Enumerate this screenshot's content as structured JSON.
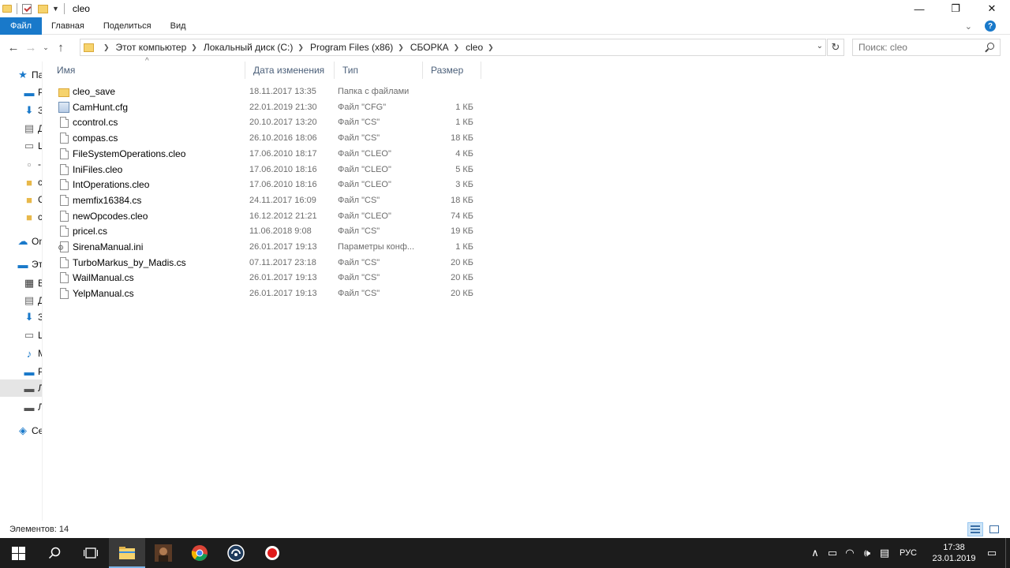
{
  "window": {
    "title": "cleo",
    "controls": [
      "minimize-icon",
      "restore-icon",
      "close-icon"
    ]
  },
  "ribbon": {
    "tabs": [
      "Файл",
      "Главная",
      "Поделиться",
      "Вид"
    ]
  },
  "address": {
    "crumbs": [
      "Этот компьютер",
      "Локальный диск (C:)",
      "Program Files (x86)",
      "СБОРКА",
      "cleo"
    ]
  },
  "search": {
    "placeholder": "Поиск: cleo"
  },
  "sidebar": {
    "items": [
      {
        "label": "Па",
        "icon": "star-icon",
        "color": "#1979ca"
      },
      {
        "label": "Р",
        "icon": "desktop-icon",
        "color": "#1979ca"
      },
      {
        "label": "З",
        "icon": "download-icon",
        "color": "#1979ca"
      },
      {
        "label": "Д",
        "icon": "document-icon",
        "color": "#666666"
      },
      {
        "label": "Ш",
        "icon": "window-icon",
        "color": "#666666"
      },
      {
        "label": "-",
        "icon": "file-icon",
        "color": "#888888"
      },
      {
        "label": "с",
        "icon": "folder-icon",
        "color": "#e8b84a"
      },
      {
        "label": "С",
        "icon": "folder-icon",
        "color": "#e8b84a"
      },
      {
        "label": "с",
        "icon": "folder-icon",
        "color": "#e8b84a"
      },
      {
        "label": "On",
        "icon": "cloud-icon",
        "color": "#1979ca"
      },
      {
        "label": "Эт",
        "icon": "computer-icon",
        "color": "#1979ca"
      },
      {
        "label": "В",
        "icon": "video-icon",
        "color": "#333333"
      },
      {
        "label": "Д",
        "icon": "document-icon",
        "color": "#666666"
      },
      {
        "label": "З",
        "icon": "download-icon",
        "color": "#1979ca"
      },
      {
        "label": "Ш",
        "icon": "window-icon",
        "color": "#666666"
      },
      {
        "label": "М",
        "icon": "music-icon",
        "color": "#1979ca"
      },
      {
        "label": "Р",
        "icon": "desktop-icon",
        "color": "#1979ca"
      },
      {
        "label": "Л",
        "icon": "drive-icon",
        "color": "#555555"
      },
      {
        "label": "Л",
        "icon": "drive-icon",
        "color": "#555555"
      },
      {
        "label": "Се",
        "icon": "network-icon",
        "color": "#1979ca"
      }
    ]
  },
  "columns": [
    "Имя",
    "Дата изменения",
    "Тип",
    "Размер"
  ],
  "files": [
    {
      "name": "cleo_save",
      "date": "18.11.2017 13:35",
      "type": "Папка с файлами",
      "size": "",
      "kind": "folder"
    },
    {
      "name": "CamHunt.cfg",
      "date": "22.01.2019 21:30",
      "type": "Файл \"CFG\"",
      "size": "1 КБ",
      "kind": "cfg"
    },
    {
      "name": "ccontrol.cs",
      "date": "20.10.2017 13:20",
      "type": "Файл \"CS\"",
      "size": "1 КБ",
      "kind": "file"
    },
    {
      "name": "compas.cs",
      "date": "26.10.2016 18:06",
      "type": "Файл \"CS\"",
      "size": "18 КБ",
      "kind": "file"
    },
    {
      "name": "FileSystemOperations.cleo",
      "date": "17.06.2010 18:17",
      "type": "Файл \"CLEO\"",
      "size": "4 КБ",
      "kind": "file"
    },
    {
      "name": "IniFiles.cleo",
      "date": "17.06.2010 18:16",
      "type": "Файл \"CLEO\"",
      "size": "5 КБ",
      "kind": "file"
    },
    {
      "name": "IntOperations.cleo",
      "date": "17.06.2010 18:16",
      "type": "Файл \"CLEO\"",
      "size": "3 КБ",
      "kind": "file"
    },
    {
      "name": "memfix16384.cs",
      "date": "24.11.2017 16:09",
      "type": "Файл \"CS\"",
      "size": "18 КБ",
      "kind": "file"
    },
    {
      "name": "newOpcodes.cleo",
      "date": "16.12.2012 21:21",
      "type": "Файл \"CLEO\"",
      "size": "74 КБ",
      "kind": "file"
    },
    {
      "name": "pricel.cs",
      "date": "11.06.2018 9:08",
      "type": "Файл \"CS\"",
      "size": "19 КБ",
      "kind": "file"
    },
    {
      "name": "SirenaManual.ini",
      "date": "26.01.2017 19:13",
      "type": "Параметры конф...",
      "size": "1 КБ",
      "kind": "ini"
    },
    {
      "name": "TurboMarkus_by_Madis.cs",
      "date": "07.11.2017 23:18",
      "type": "Файл \"CS\"",
      "size": "20 КБ",
      "kind": "file"
    },
    {
      "name": "WailManual.cs",
      "date": "26.01.2017 19:13",
      "type": "Файл \"CS\"",
      "size": "20 КБ",
      "kind": "file"
    },
    {
      "name": "YelpManual.cs",
      "date": "26.01.2017 19:13",
      "type": "Файл \"CS\"",
      "size": "20 КБ",
      "kind": "file"
    }
  ],
  "status": {
    "count": "Элементов: 14"
  },
  "taskbar": {
    "apps": [
      "start-icon",
      "search-icon",
      "task-view-icon",
      "file-explorer-icon",
      "game-icon",
      "chrome-icon",
      "teamspeak-icon",
      "record-icon"
    ],
    "lang": "РУС",
    "time": "17:38",
    "date": "23.01.2019"
  },
  "colors": {
    "accent": "#1979ca",
    "taskbar": "#1c1c1c",
    "header_text": "#4c607a"
  }
}
